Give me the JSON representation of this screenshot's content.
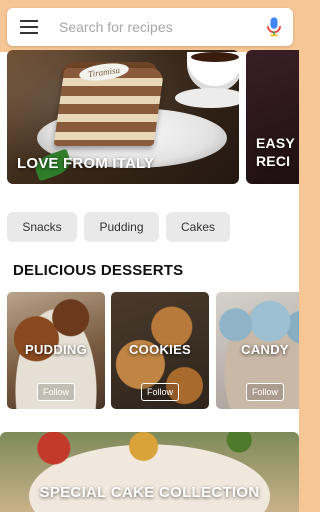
{
  "search": {
    "placeholder": "Search for recipes",
    "menu_icon": "hamburger-menu-icon",
    "mic_icon": "microphone-icon"
  },
  "colors": {
    "status_bar": "#f7c695",
    "chip_background": "#e9e9e9",
    "mic_blue": "#4285f4",
    "mic_red": "#ea4335",
    "mic_yellow": "#fbbc05",
    "mic_green": "#34a853"
  },
  "featured": [
    {
      "title": "LOVE FROM ITALY",
      "image_label": "Tiramisu"
    },
    {
      "title": "EASY\nRECI"
    }
  ],
  "chips": [
    "Snacks",
    "Pudding",
    "Cakes"
  ],
  "section": {
    "heading": "DELICIOUS DESSERTS"
  },
  "categories": [
    {
      "title": "PUDDING",
      "follow_label": "Follow"
    },
    {
      "title": "COOKIES",
      "follow_label": "Follow"
    },
    {
      "title": "CANDY",
      "follow_label": "Follow"
    }
  ],
  "special": {
    "title": "SPECIAL CAKE COLLECTION"
  }
}
